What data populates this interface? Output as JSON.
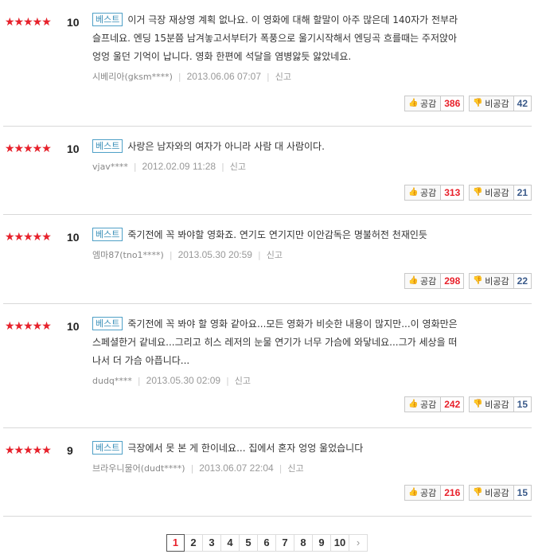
{
  "reviews": [
    {
      "rating": 10,
      "best_label": "베스트",
      "lines": [
        "이거 극장 재상영 계획 없나요. 이 영화에 대해 할말이 아주 많은데 140자가 전부라",
        "슬프네요. 엔딩 15분쯤 남겨놓고서부터가 폭풍으로 울기시작해서 엔딩곡 흐를때는 주저앉아",
        "엉엉 울던 기억이 납니다. 영화 한편에 석달을 염병앓듯 앓았네요."
      ],
      "user": "시베리아(gksm****)",
      "date": "2013.06.06 07:07",
      "report": "신고",
      "like_label": "공감",
      "like_count": "386",
      "dislike_label": "비공감",
      "dislike_count": "42"
    },
    {
      "rating": 10,
      "best_label": "베스트",
      "lines": [
        "사랑은 남자와의 여자가 아니라 사람 대 사람이다."
      ],
      "user": "vjav****",
      "date": "2012.02.09 11:28",
      "report": "신고",
      "like_label": "공감",
      "like_count": "313",
      "dislike_label": "비공감",
      "dislike_count": "21"
    },
    {
      "rating": 10,
      "best_label": "베스트",
      "lines": [
        "죽기전에 꼭 봐야할 영화죠. 연기도 연기지만 이안감독은 명불허전 천재인듯"
      ],
      "user": "엠마87(tno1****)",
      "date": "2013.05.30 20:59",
      "report": "신고",
      "like_label": "공감",
      "like_count": "298",
      "dislike_label": "비공감",
      "dislike_count": "22"
    },
    {
      "rating": 10,
      "best_label": "베스트",
      "lines": [
        "죽기전에 꼭 봐야 할 영화 같아요...모든 영화가 비슷한 내용이 많지만...이 영화만은",
        "스페셜한거 같네요...그리고 히스 레저의 눈물 연기가 너무 가슴에 와닿네요...그가 세상을 떠",
        "나서 더 가슴 아픕니다..."
      ],
      "user": "dudq****",
      "date": "2013.05.30 02:09",
      "report": "신고",
      "like_label": "공감",
      "like_count": "242",
      "dislike_label": "비공감",
      "dislike_count": "15"
    },
    {
      "rating": 9,
      "best_label": "베스트",
      "lines": [
        "극장에서 못 본 게 한이네요... 집에서 혼자 엉엉 울었습니다"
      ],
      "user": "브라우니물어(dudt****)",
      "date": "2013.06.07 22:04",
      "report": "신고",
      "like_label": "공감",
      "like_count": "216",
      "dislike_label": "비공감",
      "dislike_count": "15"
    }
  ],
  "pagination": {
    "pages": [
      "1",
      "2",
      "3",
      "4",
      "5",
      "6",
      "7",
      "8",
      "9",
      "10"
    ],
    "current": "1",
    "next_icon": "chevron-right-icon"
  },
  "colors": {
    "star": "#e8212b",
    "like_count": "#e8212b",
    "dislike_count": "#3a5a8a",
    "best_badge": "#3a8fb8"
  }
}
